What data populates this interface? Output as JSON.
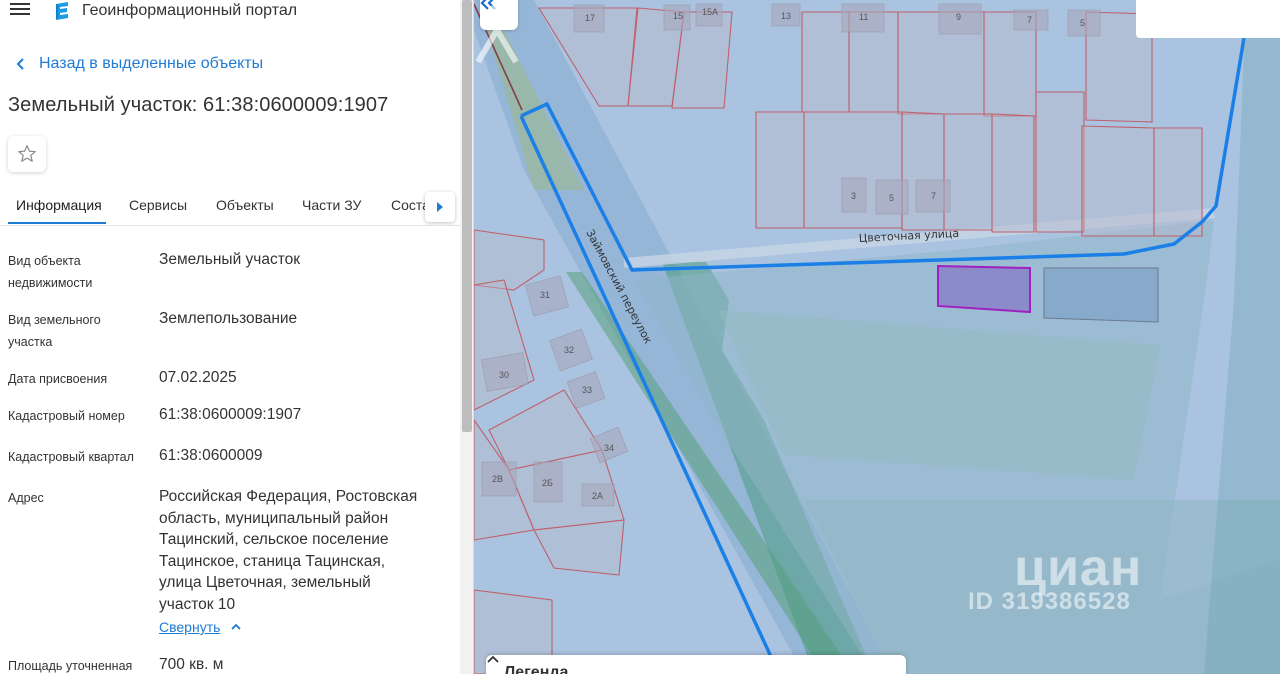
{
  "header": {
    "portal_title": "Геоинформационный портал"
  },
  "back_link": {
    "label": "Назад в выделенные объекты"
  },
  "object": {
    "title": "Земельный участок: 61:38:0600009:1907"
  },
  "tabs": [
    {
      "label": "Информация",
      "active": true
    },
    {
      "label": "Сервисы",
      "active": false
    },
    {
      "label": "Объекты",
      "active": false
    },
    {
      "label": "Части ЗУ",
      "active": false
    },
    {
      "label": "Соста",
      "active": false
    }
  ],
  "fields": [
    {
      "label_lines": [
        "Вид объекта",
        "недвижимости"
      ],
      "value_lines": [
        "Земельный участок"
      ]
    },
    {
      "label_lines": [
        "Вид земельного",
        "участка"
      ],
      "value_lines": [
        "Землепользование"
      ]
    },
    {
      "label_lines": [
        "Дата присвоения"
      ],
      "value_lines": [
        "07.02.2025"
      ]
    },
    {
      "label_lines": [
        "Кадастровый номер"
      ],
      "value_lines": [
        "61:38:0600009:1907"
      ]
    },
    {
      "label_lines": [
        "Кадастровый квартал"
      ],
      "value_lines": [
        "61:38:0600009"
      ]
    },
    {
      "label_lines": [
        "Адрес"
      ],
      "value_lines": [
        "Российская Федерация, Ростовская",
        "область, муниципальный район",
        "Тацинский, сельское поселение",
        "Тацинское, станица Тацинская,",
        "улица Цветочная, земельный",
        "участок 10"
      ]
    },
    {
      "label_lines": [
        "Площадь уточненная"
      ],
      "value_lines": [
        "700 кв. м"
      ]
    }
  ],
  "collapse_link": {
    "label": "Свернуть"
  },
  "map": {
    "street_labels": {
      "tsvetochnaya": "Цветочная улица",
      "zaymovsky": "Займовский переулок"
    },
    "house_numbers": {
      "h17": "17",
      "h15": "15",
      "h15a": "15А",
      "h13": "13",
      "h11": "11",
      "h9": "9",
      "h7top": "7",
      "h5top": "5",
      "h3": "3",
      "h5": "5",
      "h7": "7",
      "h31": "31",
      "h32": "32",
      "h30": "30",
      "h33": "33",
      "h34": "34",
      "h2v": "2В",
      "h2b": "2Б",
      "h2a": "2А"
    },
    "legend_label": "Легенда",
    "watermark": {
      "brand": "циан",
      "id": "ID 319386528"
    },
    "colors": {
      "highlight_outline": "#1a7fe6",
      "selected_parcel": "#a020c0",
      "parcel_border": "#c0606a"
    }
  },
  "icons": {
    "menu": "menu-icon",
    "logo": "portal-logo-icon",
    "back": "chevron-left-icon",
    "star": "star-icon",
    "tabs_next": "caret-right-icon",
    "collapse": "chevron-up-icon",
    "map_collapse": "double-chevron-left-icon",
    "legend": "chevron-up-icon"
  }
}
